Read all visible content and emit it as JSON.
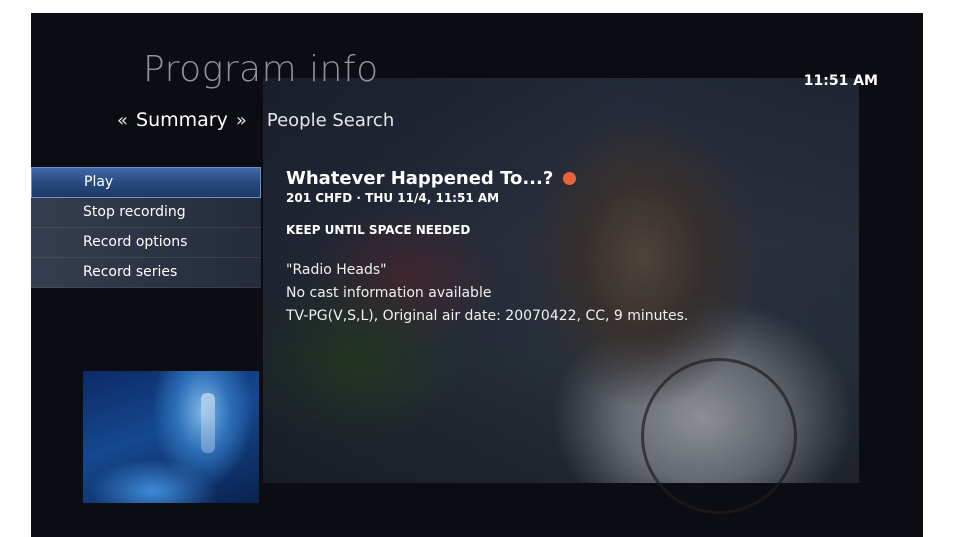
{
  "header": {
    "title": "Program info",
    "clock": "11:51 AM"
  },
  "tabs": {
    "left_arrow": "«",
    "active": "Summary",
    "right_arrow": "»",
    "next": "People Search"
  },
  "menu": {
    "items": [
      {
        "label": "Play",
        "selected": true
      },
      {
        "label": "Stop recording",
        "selected": false
      },
      {
        "label": "Record options",
        "selected": false
      },
      {
        "label": "Record series",
        "selected": false
      }
    ]
  },
  "program": {
    "title": "Whatever Happened To...?",
    "channel_time": "201 CHFD · THU 11/4, 11:51 AM",
    "keep": "KEEP UNTIL SPACE NEEDED",
    "episode": "\"Radio Heads\"",
    "cast": "No cast information available",
    "details": "TV-PG(V,S,L), Original air date: 20070422, CC, 9 minutes."
  },
  "colors": {
    "recording_indicator": "#e8633a",
    "selected_item": "#2f5694",
    "background": "#0b0d13"
  },
  "icons": {
    "recording_indicator": "record-dot-icon"
  }
}
